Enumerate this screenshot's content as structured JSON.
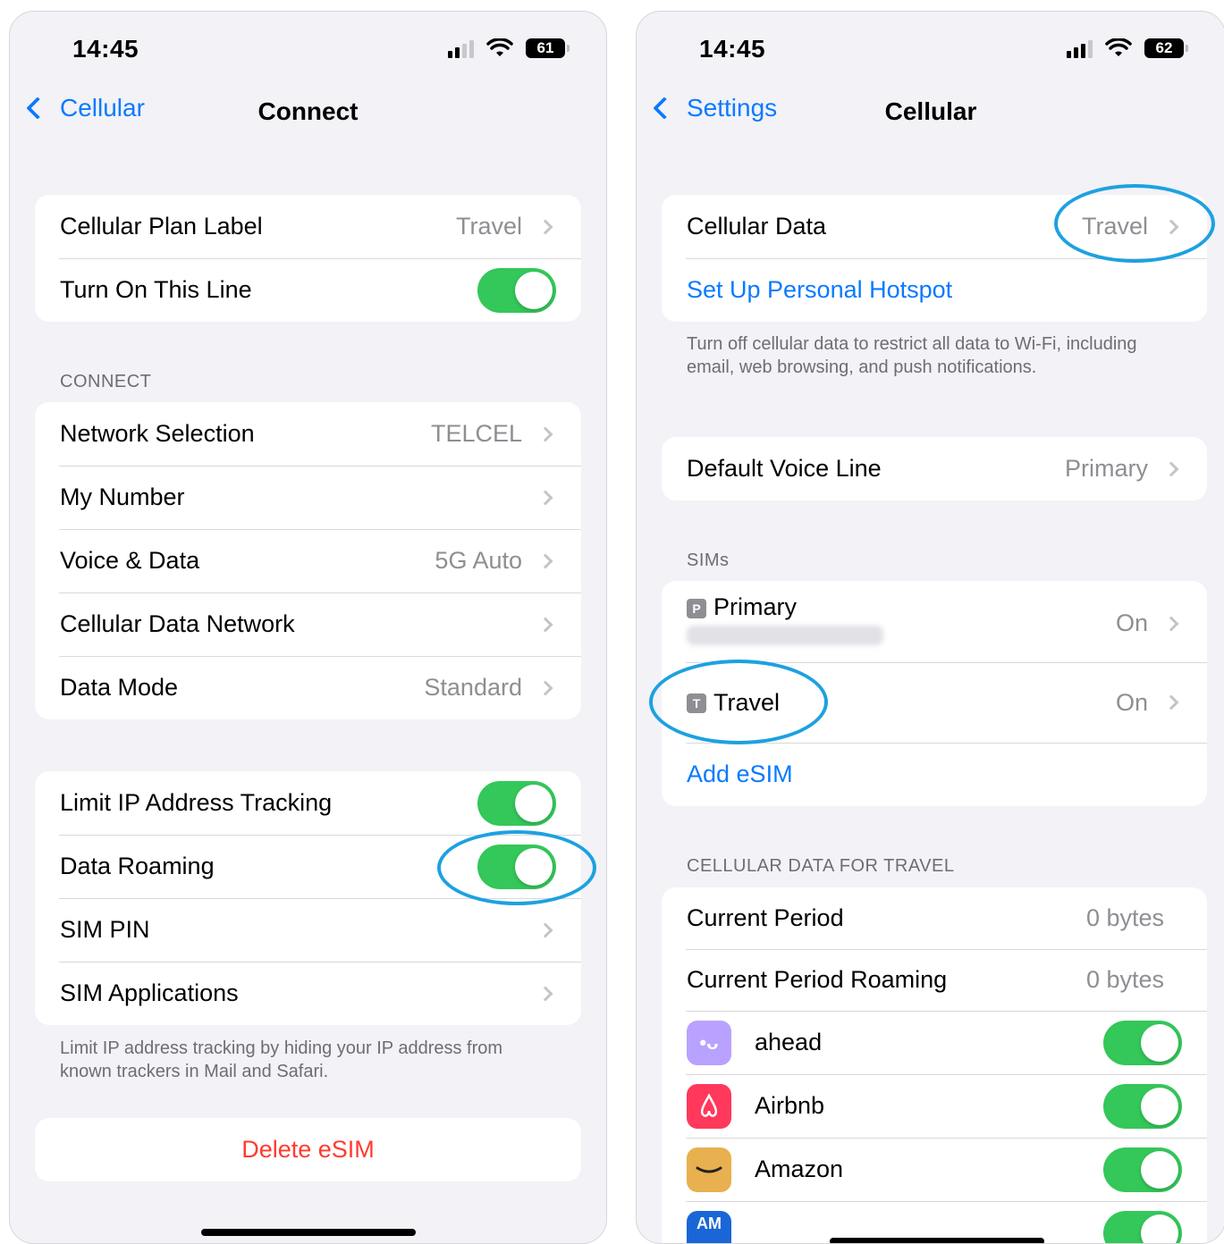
{
  "left": {
    "status_time": "14:45",
    "battery": "61",
    "nav": {
      "back_label": "Cellular",
      "title": "Connect"
    },
    "group1": [
      {
        "label": "Cellular Plan Label",
        "value": "Travel"
      },
      {
        "label": "Turn On This Line",
        "toggle": true
      }
    ],
    "connect_header": "CONNECT",
    "group2": [
      {
        "label": "Network Selection",
        "value": "TELCEL"
      },
      {
        "label": "My Number",
        "value": ""
      },
      {
        "label": "Voice & Data",
        "value": "5G Auto"
      },
      {
        "label": "Cellular Data Network",
        "value": ""
      },
      {
        "label": "Data Mode",
        "value": "Standard"
      }
    ],
    "group3": [
      {
        "label": "Limit IP Address Tracking",
        "toggle": true
      },
      {
        "label": "Data Roaming",
        "toggle": true
      },
      {
        "label": "SIM PIN"
      },
      {
        "label": "SIM Applications"
      }
    ],
    "footer_note": "Limit IP address tracking by hiding your IP address from known trackers in Mail and Safari.",
    "delete_label": "Delete eSIM"
  },
  "right": {
    "status_time": "14:45",
    "battery": "62",
    "nav": {
      "back_label": "Settings",
      "title": "Cellular"
    },
    "group1": [
      {
        "label": "Cellular Data",
        "value": "Travel"
      },
      {
        "label": "Set Up Personal Hotspot"
      }
    ],
    "data_note": "Turn off cellular data to restrict all data to Wi-Fi, including email, web browsing, and push notifications.",
    "voice": {
      "label": "Default Voice Line",
      "value": "Primary"
    },
    "sims_header": "SIMs",
    "sims": [
      {
        "badge": "P",
        "label": "Primary",
        "value": "On"
      },
      {
        "badge": "T",
        "label": "Travel",
        "value": "On"
      }
    ],
    "add_esim": "Add eSIM",
    "usage_header": "CELLULAR DATA FOR TRAVEL",
    "usage": [
      {
        "label": "Current Period",
        "value": "0 bytes"
      },
      {
        "label": "Current Period Roaming",
        "value": "0 bytes"
      }
    ],
    "apps": [
      {
        "name": "ahead",
        "color": "#b9a2ff"
      },
      {
        "name": "Airbnb",
        "color": "#ff385c"
      },
      {
        "name": "Amazon",
        "color": "#e8b04f"
      }
    ],
    "partial_app_icon": "AM"
  },
  "colors": {
    "accent": "#0a7aff",
    "toggle_on": "#34c759",
    "destructive": "#ff3b30",
    "highlight": "#1da1e0"
  }
}
